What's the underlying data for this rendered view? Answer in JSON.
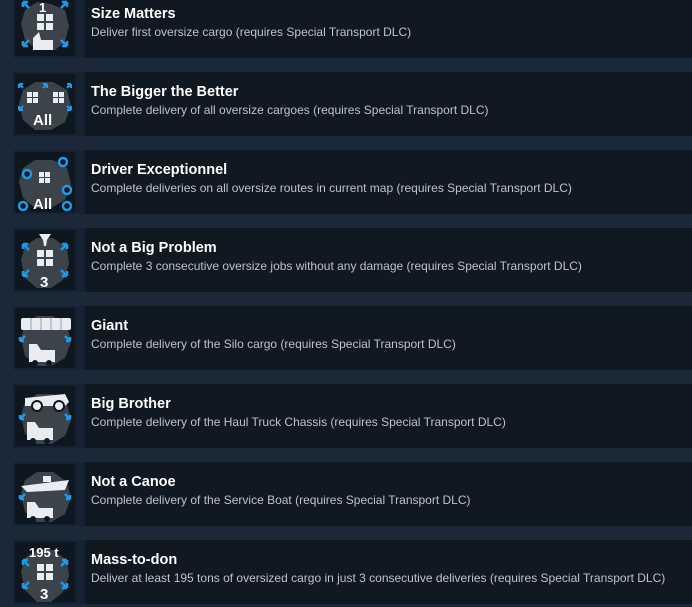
{
  "achievements": [
    {
      "title": "Size Matters",
      "description": "Deliver first oversize cargo (requires Special Transport DLC)",
      "icon": "thumbs-up-cargo-icon",
      "icon_text": "1"
    },
    {
      "title": "The Bigger the Better",
      "description": "Complete delivery of all oversize cargoes (requires Special Transport DLC)",
      "icon": "all-cargo-icon",
      "icon_text": "All"
    },
    {
      "title": "Driver Exceptionnel",
      "description": "Complete deliveries on all oversize routes in current map (requires Special Transport DLC)",
      "icon": "all-routes-icon",
      "icon_text": "All"
    },
    {
      "title": "Not a Big Problem",
      "description": "Complete 3 consecutive oversize jobs without any damage (requires Special Transport DLC)",
      "icon": "no-damage-icon",
      "icon_text": "3"
    },
    {
      "title": "Giant",
      "description": "Complete delivery of the Silo cargo (requires Special Transport DLC)",
      "icon": "silo-truck-icon",
      "icon_text": ""
    },
    {
      "title": "Big Brother",
      "description": "Complete delivery of the Haul Truck Chassis (requires Special Transport DLC)",
      "icon": "haul-truck-icon",
      "icon_text": ""
    },
    {
      "title": "Not a Canoe",
      "description": "Complete delivery of the Service Boat (requires Special Transport DLC)",
      "icon": "boat-truck-icon",
      "icon_text": ""
    },
    {
      "title": "Mass-to-don",
      "description": "Deliver at least 195 tons of oversized cargo in just 3 consecutive deliveries (requires Special Transport DLC)",
      "icon": "weight-cargo-icon",
      "icon_text": "195 t",
      "icon_text_2": "3"
    }
  ],
  "colors": {
    "background": "#1b2838",
    "row": "#101822",
    "title": "#ffffff",
    "description": "#b9c4cd",
    "accent": "#1e9be8"
  }
}
